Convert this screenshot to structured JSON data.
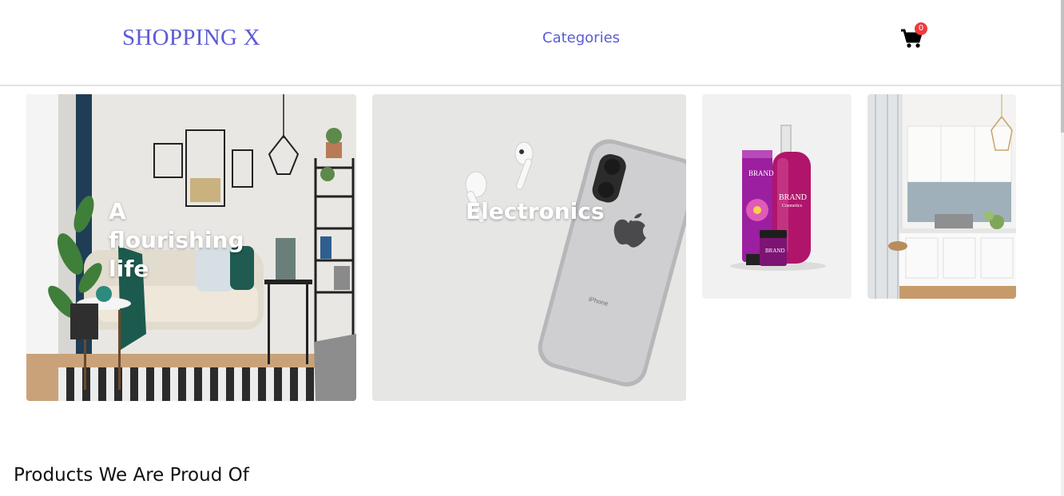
{
  "header": {
    "brand": "SHOPPING X",
    "nav_categories": "Categories",
    "cart_count": "0",
    "cart_icon": "shopping-cart-icon",
    "brand_color": "#5b5bd6",
    "badge_color": "#ee3b3b"
  },
  "tiles": [
    {
      "title": "A flourishing life",
      "image": "living-room-photo"
    },
    {
      "title": "Electronics",
      "image": "phone-earbuds-photo"
    },
    {
      "title": "",
      "image": "cosmetics-photo",
      "product_text": [
        "BRAND",
        "Cosmetics"
      ]
    },
    {
      "title": "",
      "image": "kitchen-photo"
    }
  ],
  "section": {
    "title": "Products We Are Proud Of"
  }
}
